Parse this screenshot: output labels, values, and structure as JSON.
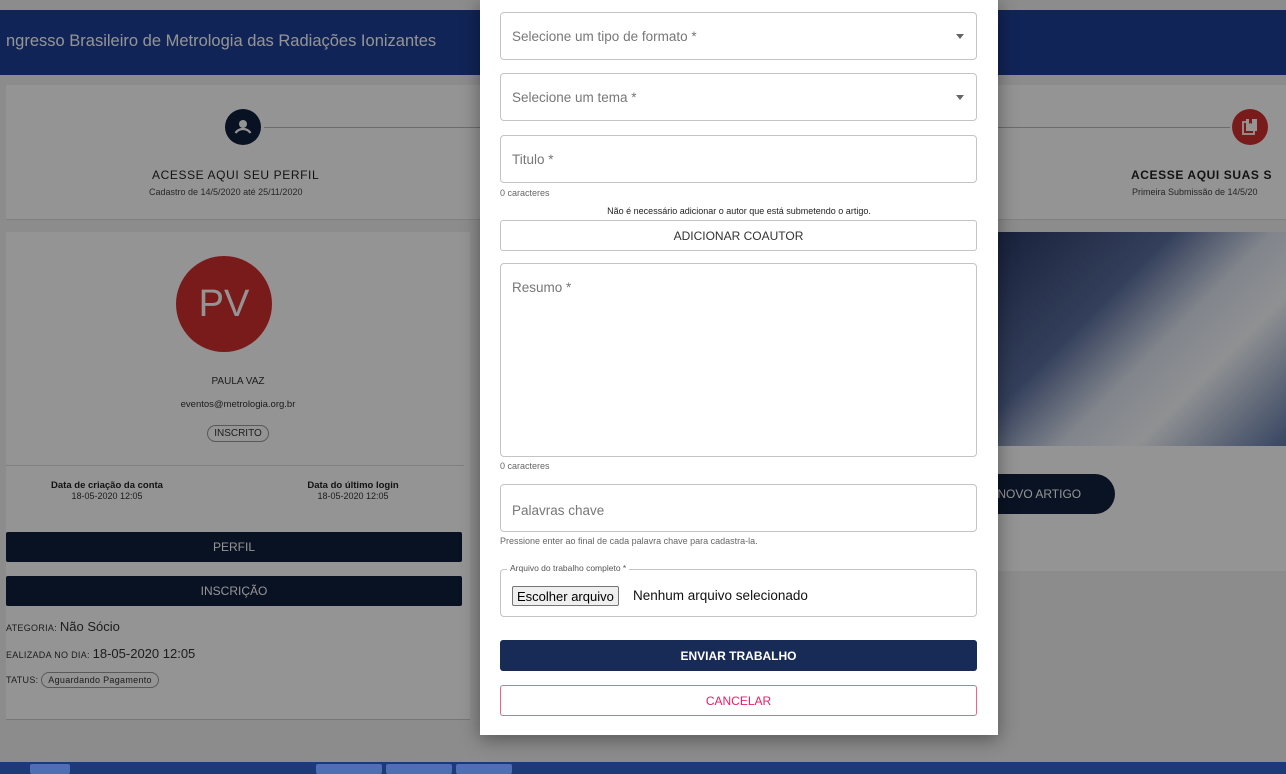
{
  "header": {
    "title": "ngresso Brasileiro de Metrologia das Radiações Ionizantes"
  },
  "steps": [
    {
      "icon": "account-circle-icon",
      "title": "ACESSE AQUI SEU PERFIL",
      "subtitle": "Cadastro de 14/5/2020 até 25/11/2020"
    },
    {
      "icon": "library-book-icon",
      "title": "ACESSE AQUI SUAS S",
      "subtitle": "Primeira Submissão de 14/5/20"
    }
  ],
  "profile": {
    "initials": "PV",
    "name": "PAULA VAZ",
    "email": "eventos@metrologia.org.br",
    "badge": "INSCRITO",
    "created_label": "Data de criação da conta",
    "created_value": "18-05-2020 12:05",
    "last_login_label": "Data do último login",
    "last_login_value": "18-05-2020 12:05",
    "btn_profile": "PERFIL",
    "btn_registration": "INSCRIÇÃO",
    "category_label": "ATEGORIA:",
    "category_value": "Não Sócio",
    "done_label": "EALIZADA NO DIA:",
    "done_value": "18-05-2020 12:05",
    "status_label": "TATUS:",
    "status_value": "Aguardando Pagamento"
  },
  "right": {
    "new_article": "M NOVO ARTIGO"
  },
  "modal": {
    "format_label": "Selecione um tipo de formato *",
    "theme_label": "Selecione um tema *",
    "title_label": "Titulo *",
    "title_count": "0 caracteres",
    "coauthor_note": "Não é necessário adicionar o autor que está submetendo o artigo.",
    "add_coauthor": "ADICIONAR COAUTOR",
    "summary_label": "Resumo *",
    "summary_count": "0 caracteres",
    "keywords_label": "Palavras chave",
    "keywords_hint": "Pressione enter ao final de cada palavra chave para cadastra-la.",
    "file_legend": "Arquivo do trabalho completo *",
    "file_button": "Escolher arquivo",
    "file_status": "Nenhum arquivo selecionado",
    "submit": "ENVIAR TRABALHO",
    "cancel": "CANCELAR"
  },
  "colors": {
    "primary": "#1e3f96",
    "dark": "#0f1f3d",
    "avatar": "#d32f2f",
    "cancel": "#e91e63"
  }
}
